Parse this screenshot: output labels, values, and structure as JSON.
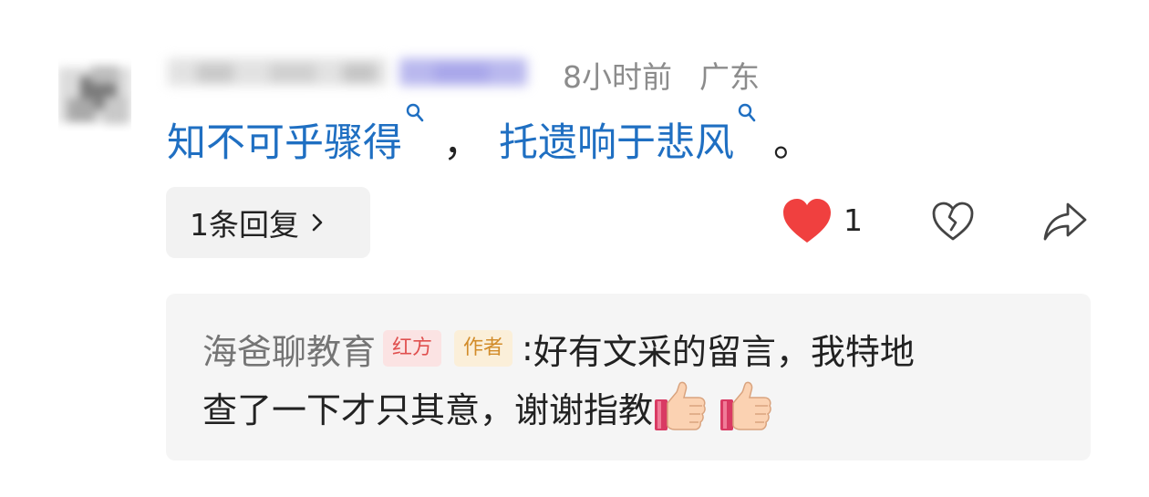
{
  "comment": {
    "time": "8小时前",
    "location": "广东",
    "segments": {
      "kw1": "知不可乎骤得",
      "sep": "，",
      "kw2": "托遗响于悲风",
      "end": "。"
    }
  },
  "actions": {
    "reply_count_label": "1条回复",
    "like_count": "1",
    "like_color": "#f0403f"
  },
  "reply": {
    "author": "海爸聊教育",
    "badge_red": "红方",
    "badge_author": "作者",
    "colon": ":",
    "text_line1": "好有文采的留言，我特地",
    "text_line2": "查了一下才只其意，谢谢指教",
    "emojis": [
      "thumbs-up",
      "thumbs-up"
    ]
  },
  "colors": {
    "link_blue": "#1f6fc2",
    "meta_gray": "#8c8c8c",
    "reply_bg": "#f5f5f5",
    "pill_bg": "#f2f2f2"
  }
}
